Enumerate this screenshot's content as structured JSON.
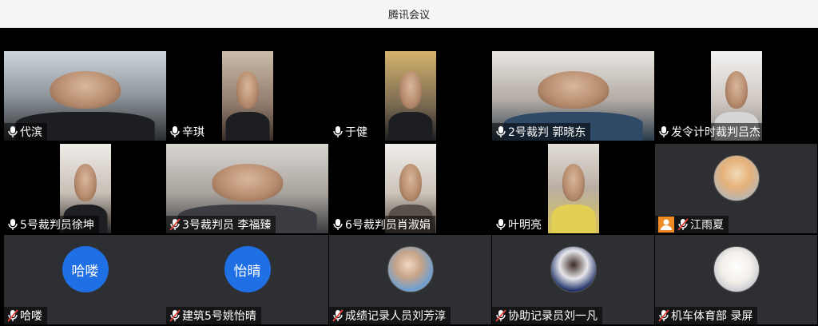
{
  "window": {
    "title": "腾讯会议"
  },
  "participants": [
    {
      "name": "代滨",
      "mic": "on",
      "video": "wide"
    },
    {
      "name": "辛琪",
      "mic": "on",
      "video": "narrow"
    },
    {
      "name": "于健",
      "mic": "on",
      "video": "narrow"
    },
    {
      "name": "2号裁判 郭晓东",
      "mic": "on",
      "video": "wide"
    },
    {
      "name": "发令计时裁判吕杰",
      "mic": "on",
      "video": "narrow"
    },
    {
      "name": "5号裁判员徐坤",
      "mic": "on",
      "video": "narrow"
    },
    {
      "name": "3号裁判员 李福臻",
      "mic": "muted",
      "video": "wide"
    },
    {
      "name": "6号裁判员肖淑娟",
      "mic": "on",
      "video": "narrow"
    },
    {
      "name": "叶明亮",
      "mic": "on",
      "video": "narrow"
    },
    {
      "name": "江雨夏",
      "mic": "muted",
      "video": "off"
    },
    {
      "name": "哈喽",
      "mic": "muted",
      "video": "off",
      "avatar_text": "哈喽"
    },
    {
      "name": "建筑5号姚怡晴",
      "mic": "muted",
      "video": "off",
      "avatar_text": "怡晴"
    },
    {
      "name": "成绩记录人员刘芳淳",
      "mic": "muted",
      "video": "off"
    },
    {
      "name": "协助记录员刘一凡",
      "mic": "muted",
      "video": "off"
    },
    {
      "name": "机车体育部 录屏",
      "mic": "muted",
      "video": "off"
    }
  ],
  "colors": {
    "avatar_blue": "#1f6fe5",
    "user_badge_orange": "#f08a24",
    "muted_red": "#e0433b"
  }
}
